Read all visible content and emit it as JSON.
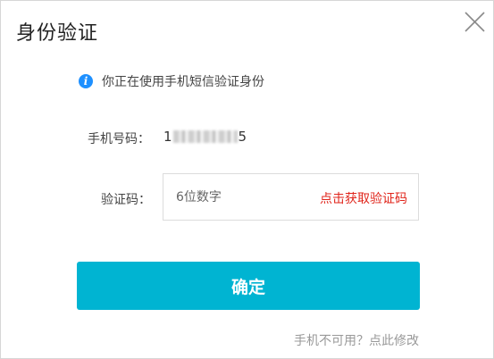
{
  "dialog": {
    "title": "身份验证",
    "close_icon": "close-icon"
  },
  "info": {
    "icon": "info-icon",
    "icon_glyph": "i",
    "text": "你正在使用手机短信验证身份",
    "icon_color": "#1e90ff"
  },
  "phone": {
    "label": "手机号码：",
    "prefix": "1",
    "suffix": "5"
  },
  "code": {
    "label": "验证码：",
    "placeholder": "6位数字",
    "value": "",
    "get_code_label": "点击获取验证码",
    "get_code_color": "#e0251b"
  },
  "confirm": {
    "label": "确定",
    "color": "#00b4d2"
  },
  "alt_link": {
    "label": "手机不可用？点此修改"
  }
}
